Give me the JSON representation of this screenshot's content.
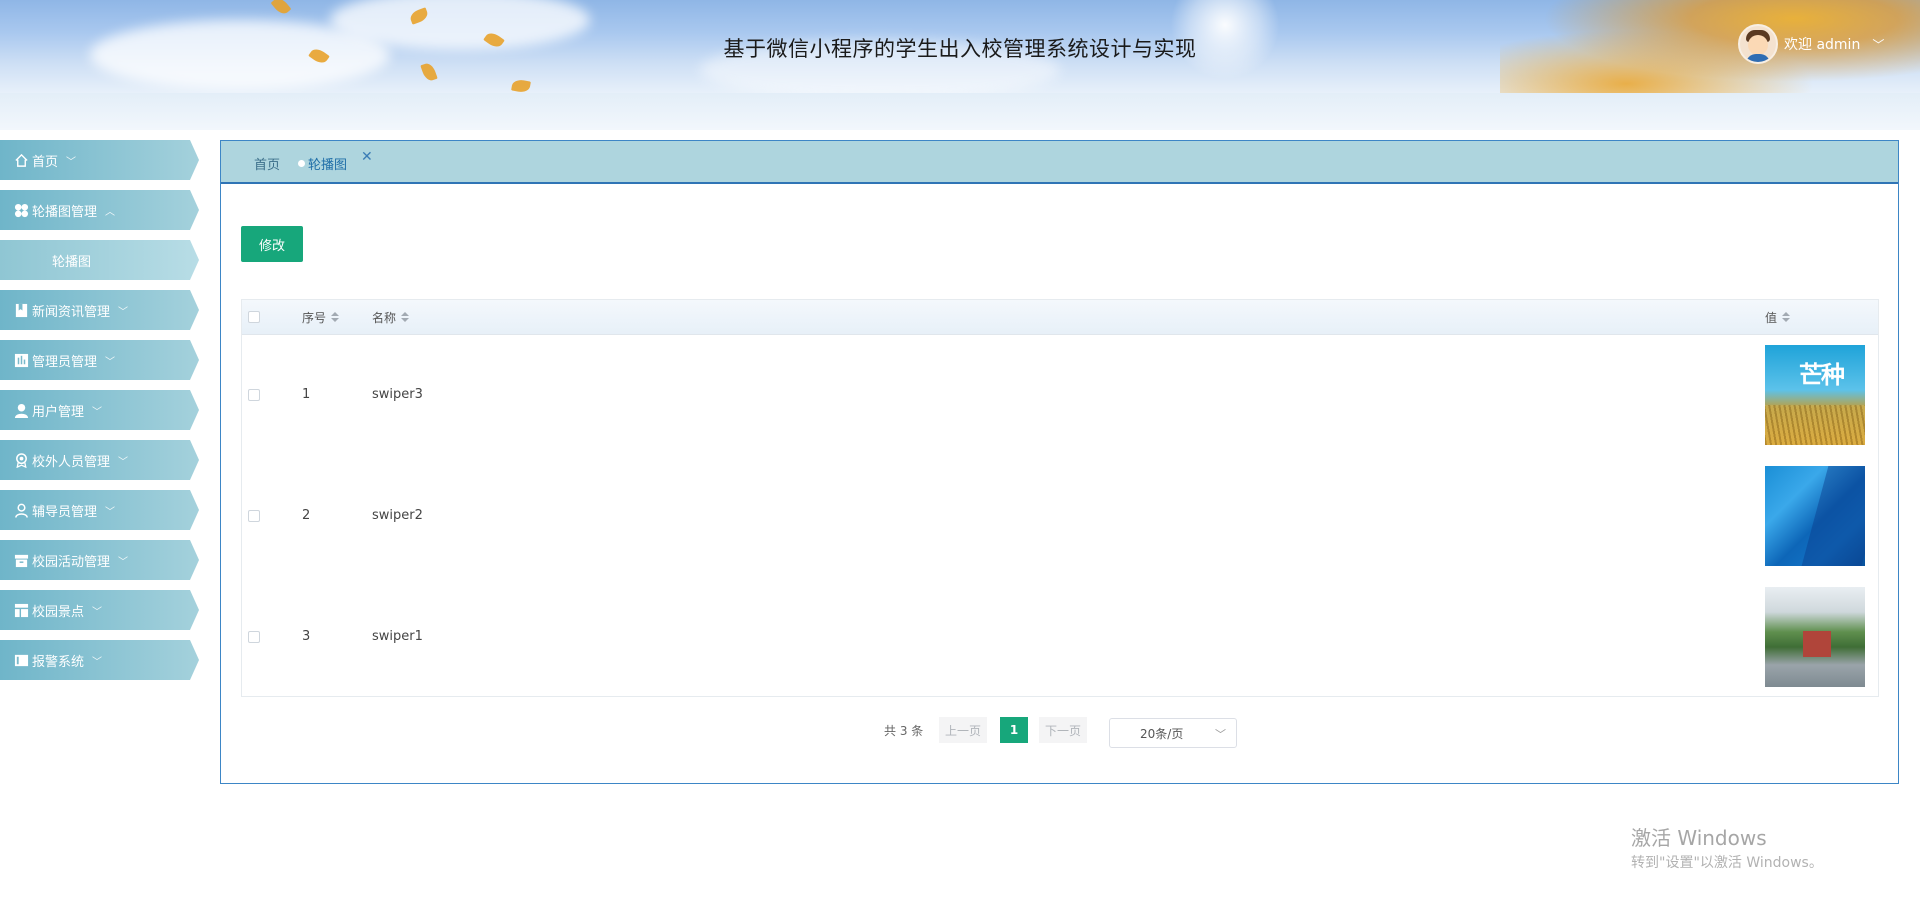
{
  "header": {
    "title": "基于微信小程序的学生出入校管理系统设计与实现",
    "welcome": "欢迎 admin",
    "user_chevron": "﹀"
  },
  "sidebar": {
    "items": [
      {
        "label": "首页",
        "icon": "home-icon",
        "chevron": "﹀"
      },
      {
        "label": "轮播图管理",
        "icon": "clover-icon",
        "chevron": "︿"
      },
      {
        "label": "轮播图",
        "sub": true
      },
      {
        "label": "新闻资讯管理",
        "icon": "bookmark-icon",
        "chevron": "﹀"
      },
      {
        "label": "管理员管理",
        "icon": "bar-chart-icon",
        "chevron": "﹀"
      },
      {
        "label": "用户管理",
        "icon": "user-icon",
        "chevron": "﹀"
      },
      {
        "label": "校外人员管理",
        "icon": "badge-icon",
        "chevron": "﹀"
      },
      {
        "label": "辅导员管理",
        "icon": "user-outline-icon",
        "chevron": "﹀"
      },
      {
        "label": "校园活动管理",
        "icon": "archive-icon",
        "chevron": "﹀"
      },
      {
        "label": "校园景点",
        "icon": "layout-icon",
        "chevron": "﹀"
      },
      {
        "label": "报警系统",
        "icon": "panel-icon",
        "chevron": "﹀"
      }
    ]
  },
  "tabs": {
    "home": "首页",
    "active": "轮播图",
    "close": "✕"
  },
  "toolbar": {
    "edit_label": "修改"
  },
  "table": {
    "columns": [
      "序号",
      "名称",
      "值"
    ],
    "rows": [
      {
        "index": "1",
        "name": "swiper3"
      },
      {
        "index": "2",
        "name": "swiper2"
      },
      {
        "index": "3",
        "name": "swiper1"
      }
    ]
  },
  "pagination": {
    "total": "共 3 条",
    "prev": "上一页",
    "current": "1",
    "next": "下一页",
    "page_size": "20条/页"
  },
  "watermark": {
    "line1": "激活 Windows",
    "line2": "转到\"设置\"以激活 Windows。"
  },
  "colors": {
    "accent": "#17a77b",
    "panel_border": "#3d86c6",
    "tabbar": "#aed5de",
    "menu": "#6fb5c9"
  }
}
